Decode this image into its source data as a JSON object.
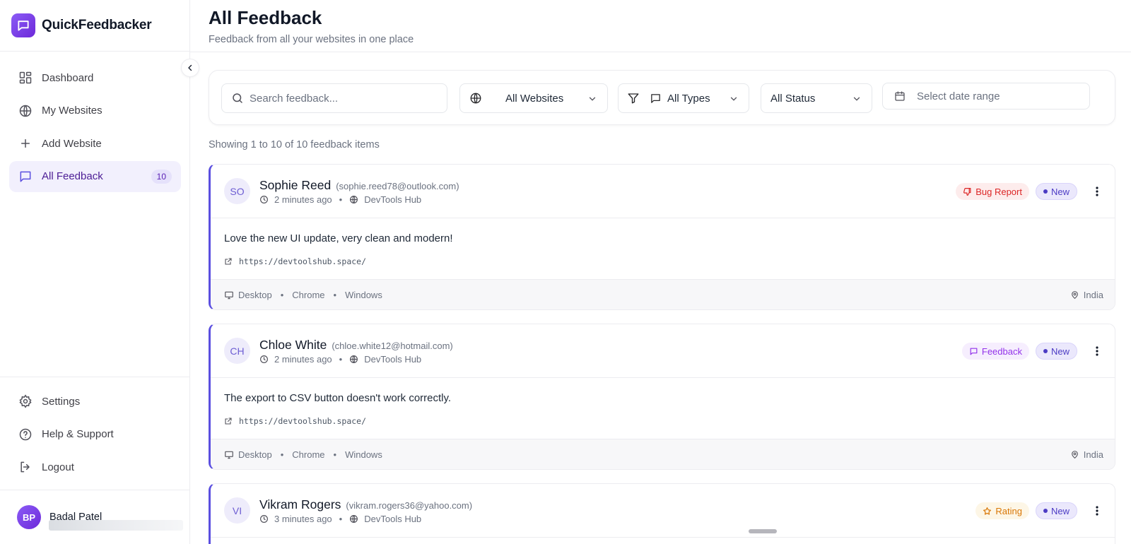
{
  "brand": {
    "name": "QuickFeedbacker"
  },
  "sidebar": {
    "items": [
      {
        "label": "Dashboard",
        "icon": "dashboard-grid-icon"
      },
      {
        "label": "My Websites",
        "icon": "globe-icon"
      },
      {
        "label": "Add Website",
        "icon": "plus-icon"
      },
      {
        "label": "All Feedback",
        "icon": "message-square-icon",
        "badge": "10",
        "active": true
      }
    ],
    "bottom_items": [
      {
        "label": "Settings",
        "icon": "gear-icon"
      },
      {
        "label": "Help & Support",
        "icon": "help-circle-icon"
      },
      {
        "label": "Logout",
        "icon": "logout-icon"
      }
    ],
    "user": {
      "initials": "BP",
      "name": "Badal Patel"
    }
  },
  "header": {
    "title": "All Feedback",
    "subtitle": "Feedback from all your websites in one place"
  },
  "filters": {
    "search_placeholder": "Search feedback...",
    "website_value": "All Websites",
    "type_value": "All Types",
    "status_value": "All Status",
    "date_placeholder": "Select date range"
  },
  "results": {
    "summary": "Showing 1 to 10 of 10 feedback items"
  },
  "feedback": [
    {
      "initials": "SO",
      "name": "Sophie Reed",
      "email": "(sophie.reed78@outlook.com)",
      "time": "2 minutes ago",
      "site": "DevTools Hub",
      "type": "Bug Report",
      "status": "New",
      "message": "Love the new UI update, very clean and modern!",
      "url": "https://devtoolshub.space/",
      "device": "Desktop",
      "browser": "Chrome",
      "os": "Windows",
      "location": "India"
    },
    {
      "initials": "CH",
      "name": "Chloe White",
      "email": "(chloe.white12@hotmail.com)",
      "time": "2 minutes ago",
      "site": "DevTools Hub",
      "type": "Feedback",
      "status": "New",
      "message": "The export to CSV button doesn't work correctly.",
      "url": "https://devtoolshub.space/",
      "device": "Desktop",
      "browser": "Chrome",
      "os": "Windows",
      "location": "India"
    },
    {
      "initials": "VI",
      "name": "Vikram Rogers",
      "email": "(vikram.rogers36@yahoo.com)",
      "time": "3 minutes ago",
      "site": "DevTools Hub",
      "type": "Rating",
      "status": "New"
    }
  ],
  "colors": {
    "accent": "#5b4fe0",
    "bug_report": "#dc2626",
    "feedback_type": "#9333ea",
    "rating": "#d97706"
  }
}
